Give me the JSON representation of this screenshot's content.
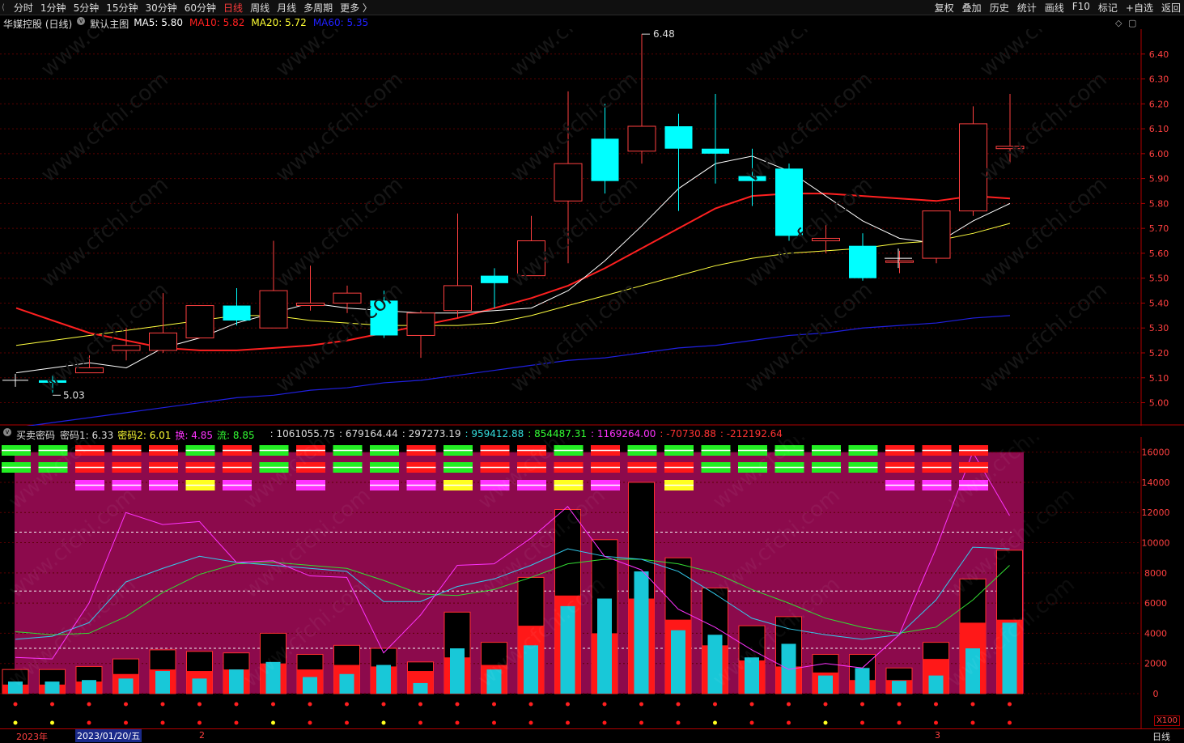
{
  "toolbar": {
    "periods": [
      "分时",
      "1分钟",
      "5分钟",
      "15分钟",
      "30分钟",
      "60分钟",
      "日线",
      "周线",
      "月线",
      "多周期",
      "更多 〉"
    ],
    "active_period": "日线",
    "actions": [
      "复权",
      "叠加",
      "历史",
      "统计",
      "画线",
      "F10",
      "标记",
      "+自选",
      "返回"
    ]
  },
  "main_chart": {
    "title": "华媒控股 (日线)",
    "indicator_name": "默认主图",
    "ma": [
      {
        "label": "MA5: 5.80",
        "color": "#ffffff"
      },
      {
        "label": "MA10: 5.82",
        "color": "#ff2020"
      },
      {
        "label": "MA20: 5.72",
        "color": "#ffff33"
      },
      {
        "label": "MA60: 5.35",
        "color": "#2020ff"
      }
    ],
    "y_ticks": [
      "6.40",
      "6.30",
      "6.20",
      "6.10",
      "6.00",
      "5.90",
      "5.80",
      "5.70",
      "5.60",
      "5.50",
      "5.40",
      "5.30",
      "5.20",
      "5.10",
      "5.00"
    ],
    "high_label": "6.48",
    "low_label": "5.03",
    "candles": [
      {
        "o": 5.09,
        "c": 5.08,
        "h": 5.11,
        "l": 5.04
      },
      {
        "o": 5.12,
        "c": 5.14,
        "h": 5.19,
        "l": 5.12
      },
      {
        "o": 5.21,
        "c": 5.23,
        "h": 5.3,
        "l": 5.17
      },
      {
        "o": 5.21,
        "c": 5.28,
        "h": 5.44,
        "l": 5.2
      },
      {
        "o": 5.26,
        "c": 5.39,
        "h": 5.39,
        "l": 5.26
      },
      {
        "o": 5.39,
        "c": 5.33,
        "h": 5.46,
        "l": 5.31
      },
      {
        "o": 5.3,
        "c": 5.45,
        "h": 5.65,
        "l": 5.3
      },
      {
        "o": 5.39,
        "c": 5.4,
        "h": 5.55,
        "l": 5.37
      },
      {
        "o": 5.4,
        "c": 5.44,
        "h": 5.47,
        "l": 5.36
      },
      {
        "o": 5.41,
        "c": 5.27,
        "h": 5.45,
        "l": 5.26
      },
      {
        "o": 5.27,
        "c": 5.36,
        "h": 5.37,
        "l": 5.18
      },
      {
        "o": 5.37,
        "c": 5.47,
        "h": 5.76,
        "l": 5.34
      },
      {
        "o": 5.51,
        "c": 5.48,
        "h": 5.54,
        "l": 5.38
      },
      {
        "o": 5.51,
        "c": 5.65,
        "h": 5.75,
        "l": 5.51
      },
      {
        "o": 5.81,
        "c": 5.96,
        "h": 6.25,
        "l": 5.56
      },
      {
        "o": 6.06,
        "c": 5.89,
        "h": 6.2,
        "l": 5.84
      },
      {
        "o": 6.01,
        "c": 6.11,
        "h": 6.48,
        "l": 5.96
      },
      {
        "o": 6.11,
        "c": 6.02,
        "h": 6.16,
        "l": 5.77
      },
      {
        "o": 6.02,
        "c": 6.0,
        "h": 6.24,
        "l": 5.88
      },
      {
        "o": 5.91,
        "c": 5.89,
        "h": 6.02,
        "l": 5.79
      },
      {
        "o": 5.94,
        "c": 5.67,
        "h": 5.96,
        "l": 5.65
      },
      {
        "o": 5.65,
        "c": 5.66,
        "h": 5.72,
        "l": 5.6
      },
      {
        "o": 5.63,
        "c": 5.5,
        "h": 5.68,
        "l": 5.49
      },
      {
        "o": 5.57,
        "c": 5.57,
        "h": 5.61,
        "l": 5.52
      },
      {
        "o": 5.58,
        "c": 5.77,
        "h": 5.77,
        "l": 5.56
      },
      {
        "o": 5.77,
        "c": 6.12,
        "h": 6.19,
        "l": 5.75
      },
      {
        "o": 6.02,
        "c": 6.03,
        "h": 6.24,
        "l": 5.96
      }
    ],
    "ma5": [
      5.14,
      5.16,
      5.14,
      5.22,
      5.26,
      5.32,
      5.36,
      5.4,
      5.38,
      5.37,
      5.36,
      5.36,
      5.37,
      5.38,
      5.45,
      5.57,
      5.71,
      5.86,
      5.96,
      5.99,
      5.93,
      5.83,
      5.73,
      5.66,
      5.64,
      5.73,
      5.8
    ],
    "ma10": [
      5.33,
      5.28,
      5.25,
      5.22,
      5.21,
      5.21,
      5.22,
      5.23,
      5.25,
      5.28,
      5.31,
      5.34,
      5.38,
      5.42,
      5.47,
      5.54,
      5.62,
      5.7,
      5.78,
      5.83,
      5.84,
      5.84,
      5.83,
      5.82,
      5.81,
      5.83,
      5.82
    ],
    "ma20": [
      5.25,
      5.27,
      5.29,
      5.31,
      5.33,
      5.35,
      5.35,
      5.33,
      5.32,
      5.31,
      5.31,
      5.31,
      5.32,
      5.35,
      5.39,
      5.43,
      5.47,
      5.51,
      5.55,
      5.58,
      5.6,
      5.61,
      5.62,
      5.64,
      5.65,
      5.68,
      5.72
    ],
    "ma60": [
      4.92,
      4.94,
      4.96,
      4.98,
      5.0,
      5.02,
      5.03,
      5.05,
      5.06,
      5.08,
      5.09,
      5.11,
      5.13,
      5.15,
      5.17,
      5.18,
      5.2,
      5.22,
      5.23,
      5.25,
      5.27,
      5.28,
      5.3,
      5.31,
      5.32,
      5.34,
      5.35
    ]
  },
  "sub_chart": {
    "indicator_name": "买卖密码",
    "values": [
      {
        "label": "密码1: 6.33",
        "color": "#dddddd"
      },
      {
        "label": "密码2: 6.01",
        "color": "#ffff33"
      },
      {
        "label": "换: 4.85",
        "color": "#ff33ff"
      },
      {
        "label": "流: 8.85",
        "color": "#33ff33"
      },
      {
        "label": ": 1061055.75",
        "color": "#dddddd"
      },
      {
        "label": ": 679164.44",
        "color": "#dddddd"
      },
      {
        "label": ": 297273.19",
        "color": "#dddddd"
      },
      {
        "label": ": 959412.88",
        "color": "#33dddd"
      },
      {
        "label": ": 854487.31",
        "color": "#33ff33"
      },
      {
        "label": ": 1169264.00",
        "color": "#ff33ff"
      },
      {
        "label": ": -70730.88",
        "color": "#ff3333"
      },
      {
        "label": ": -212192.64",
        "color": "#ff3333"
      }
    ],
    "y_ticks": [
      "16000",
      "14000",
      "12000",
      "10000",
      "8000",
      "6000",
      "4000",
      "2000",
      "0"
    ],
    "bars_total": [
      1600,
      1600,
      1800,
      2300,
      2900,
      2800,
      2700,
      4000,
      2600,
      3200,
      3000,
      2100,
      5400,
      3400,
      7700,
      12200,
      10200,
      14000,
      9000,
      7000,
      4500,
      5100,
      2600,
      2600,
      1700,
      3400,
      7600,
      9500
    ],
    "bars_red": [
      600,
      600,
      800,
      1300,
      1600,
      1500,
      1600,
      2000,
      1600,
      1900,
      1800,
      1500,
      2400,
      1900,
      4500,
      6500,
      4000,
      6300,
      4900,
      3200,
      2200,
      1800,
      1400,
      900,
      900,
      2300,
      4700,
      4900
    ],
    "bars_cyan": [
      800,
      800,
      900,
      1000,
      1500,
      1000,
      1600,
      2100,
      1100,
      1300,
      1900,
      700,
      3000,
      1600,
      3200,
      5800,
      6300,
      8100,
      4200,
      3900,
      2400,
      3300,
      1200,
      1700,
      850,
      1200,
      3000,
      4700
    ],
    "line_magenta": [
      2400,
      2300,
      6000,
      12000,
      11200,
      11400,
      8700,
      8800,
      7800,
      7700,
      2700,
      5200,
      8500,
      8600,
      10300,
      12400,
      9100,
      8200,
      5600,
      4400,
      2900,
      1600,
      2000,
      1700,
      3900,
      9600,
      16000,
      11800
    ],
    "line_cyan": [
      3600,
      3800,
      4700,
      7400,
      8300,
      9100,
      8700,
      8500,
      8300,
      8100,
      6100,
      6100,
      7100,
      7600,
      8500,
      9600,
      9100,
      8900,
      8100,
      6600,
      5000,
      4300,
      3900,
      3600,
      3900,
      6200,
      9700,
      9600
    ],
    "line_green": [
      4100,
      3900,
      4000,
      5100,
      6700,
      7900,
      8600,
      8700,
      8500,
      8300,
      7500,
      6600,
      6500,
      6900,
      7700,
      8600,
      8900,
      8900,
      8600,
      8000,
      6900,
      6000,
      5000,
      4400,
      4000,
      4400,
      6200,
      8500
    ],
    "signal_row1": [
      "green",
      "green",
      "red",
      "red",
      "red",
      "green",
      "red",
      "green",
      "red",
      "green",
      "green",
      "red",
      "green",
      "red",
      "red",
      "green",
      "red",
      "green",
      "green",
      "green",
      "green",
      "green",
      "green",
      "green",
      "red",
      "red",
      "red"
    ],
    "signal_row2": [
      "green",
      "green",
      "red",
      "red",
      "red",
      "red",
      "red",
      "green",
      "red",
      "green",
      "green",
      "red",
      "green",
      "red",
      "red",
      "red",
      "red",
      "red",
      "red",
      "green",
      "green",
      "green",
      "green",
      "green",
      "red",
      "red",
      "red"
    ],
    "signal_row3": [
      "",
      "",
      "magenta",
      "magenta",
      "magenta",
      "yellow",
      "magenta",
      "",
      "magenta",
      "",
      "magenta",
      "magenta",
      "yellow",
      "magenta",
      "magenta",
      "yellow",
      "magenta",
      "",
      "yellow",
      "",
      "",
      "",
      "",
      "",
      "magenta",
      "magenta",
      "magenta"
    ],
    "dots_row2": [
      "yellow",
      "yellow",
      "red",
      "red",
      "red",
      "red",
      "red",
      "yellow",
      "red",
      "red",
      "yellow",
      "red",
      "red",
      "red",
      "red",
      "red",
      "red",
      "red",
      "red",
      "yellow",
      "red",
      "red",
      "yellow",
      "red",
      "red",
      "red",
      "red",
      "red"
    ]
  },
  "bottom": {
    "year": "2023年",
    "date": "2023/01/20/五",
    "month2": "2",
    "month3": "3",
    "scale": "X100",
    "period": "日线"
  }
}
